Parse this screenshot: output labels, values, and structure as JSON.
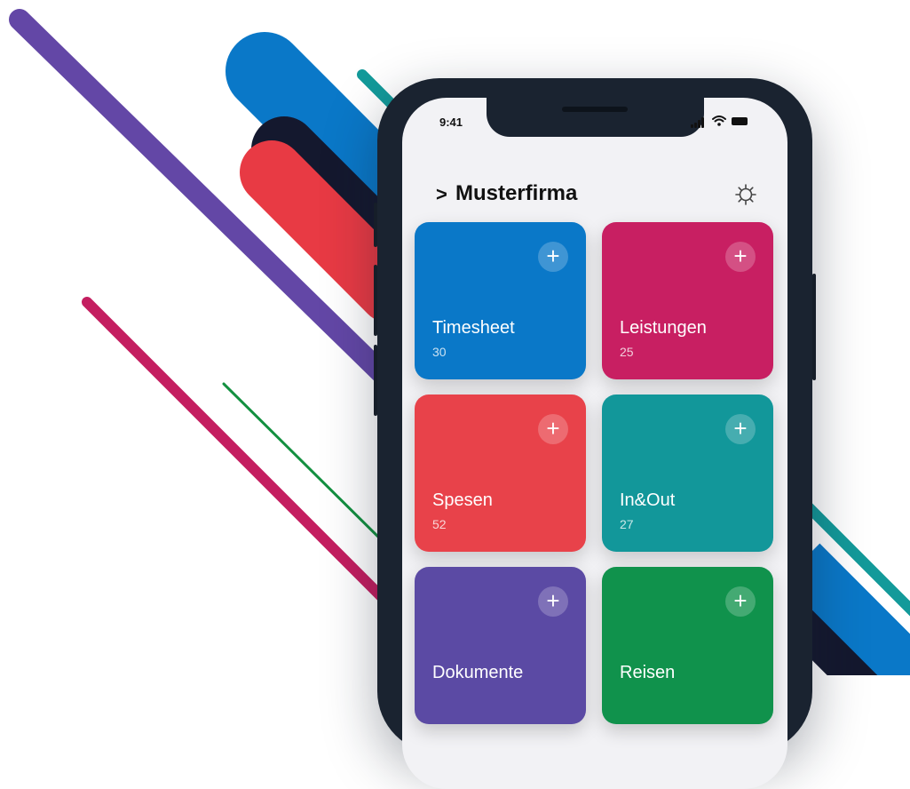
{
  "status_bar": {
    "time": "9:41"
  },
  "header": {
    "chevron": ">",
    "title": "Musterfirma"
  },
  "tiles": [
    {
      "label": "Timesheet",
      "count": "30",
      "color": "#0a78c8",
      "plus": "+"
    },
    {
      "label": "Leistungen",
      "count": "25",
      "color": "#c81f62",
      "plus": "+"
    },
    {
      "label": "Spesen",
      "count": "52",
      "color": "#e8424a",
      "plus": "+"
    },
    {
      "label": "In&Out",
      "count": "27",
      "color": "#12979a",
      "plus": "+"
    },
    {
      "label": "Dokumente",
      "count": "",
      "color": "#5b4aa4",
      "plus": "+"
    },
    {
      "label": "Reisen",
      "count": "",
      "color": "#10924c",
      "plus": "+"
    }
  ],
  "colors": {
    "background": "#ffffff",
    "phone_frame": "#1a2330",
    "screen": "#f2f2f5",
    "stripe_purple": "#6347a6",
    "stripe_blue": "#0a78c8",
    "stripe_red": "#e83a44",
    "stripe_navy": "#14182e",
    "stripe_teal": "#139a9a",
    "stripe_magenta": "#c41e60",
    "stripe_green": "#139040"
  },
  "icons": {
    "settings": "gear-icon",
    "expand": "chevron-right-icon",
    "add": "plus-icon"
  }
}
